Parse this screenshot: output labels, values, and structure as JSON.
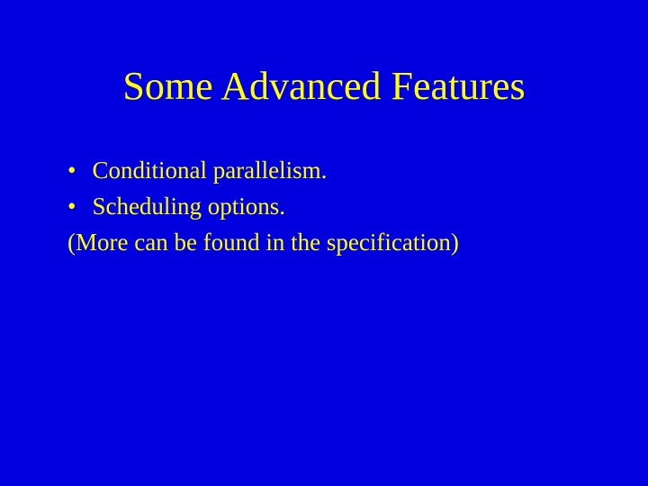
{
  "slide": {
    "title": "Some Advanced Features",
    "bullets": [
      "Conditional parallelism.",
      "Scheduling options."
    ],
    "note": "(More can be found in the specification)"
  }
}
